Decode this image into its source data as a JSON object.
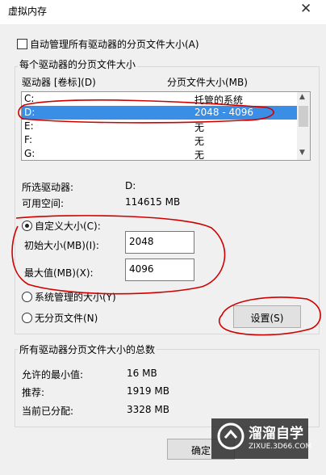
{
  "window": {
    "title": "虚拟内存",
    "close_glyph": "✕"
  },
  "auto_manage_label": "自动管理所有驱动器的分页文件大小(A)",
  "group_title": "每个驱动器的分页文件大小",
  "list": {
    "col_drive": "驱动器 [卷标](D)",
    "col_size": "分页文件大小(MB)",
    "rows": [
      {
        "drive": "C:",
        "size": "托管的系统"
      },
      {
        "drive": "D:",
        "size": "2048 - 4096"
      },
      {
        "drive": "E:",
        "size": "无"
      },
      {
        "drive": "F:",
        "size": "无"
      },
      {
        "drive": "G:",
        "size": "无"
      }
    ],
    "selected_index": 1
  },
  "selected_drive_label": "所选驱动器:",
  "selected_drive_value": "D:",
  "available_label": "可用空间:",
  "available_value": "114615 MB",
  "custom_size_label": "自定义大小(C):",
  "initial_label": "初始大小(MB)(I):",
  "initial_value": "2048",
  "max_label": "最大值(MB)(X):",
  "max_value": "4096",
  "system_managed_label": "系统管理的大小(Y)",
  "no_paging_label": "无分页文件(N)",
  "set_button": "设置(S)",
  "total_group_title": "所有驱动器分页文件大小的总数",
  "min_allowed_label": "允许的最小值:",
  "min_allowed_value": "16 MB",
  "recommended_label": "推荐:",
  "recommended_value": "1919 MB",
  "allocated_label": "当前已分配:",
  "allocated_value": "3328 MB",
  "ok_button": "确定",
  "watermark": {
    "title": "溜溜自学",
    "url": "ZIXUE.3D66.COM"
  },
  "colors": {
    "selection": "#3a8ee6",
    "annotation": "#d00000"
  }
}
